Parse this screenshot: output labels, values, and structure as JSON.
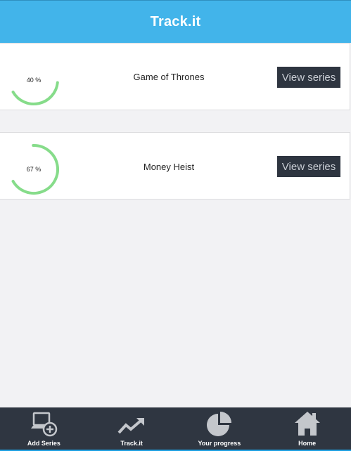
{
  "header": {
    "title": "Track.it"
  },
  "series": [
    {
      "name": "Game of Thrones",
      "progress": 40,
      "progress_label": "40 %",
      "button_label": "View series"
    },
    {
      "name": "Money Heist",
      "progress": 67,
      "progress_label": "67 %",
      "button_label": "View series"
    }
  ],
  "nav": {
    "items": [
      {
        "label": "Add Series",
        "icon": "add-series-icon"
      },
      {
        "label": "Track.it",
        "icon": "trending-up-icon"
      },
      {
        "label": "Your progress",
        "icon": "pie-chart-icon"
      },
      {
        "label": "Home",
        "icon": "home-icon"
      }
    ]
  },
  "colors": {
    "header": "#42b4ea",
    "progress": "#86dc8a",
    "button": "#2e3540",
    "nav": "#2f3641",
    "nav_icon": "#c4c7cc"
  }
}
